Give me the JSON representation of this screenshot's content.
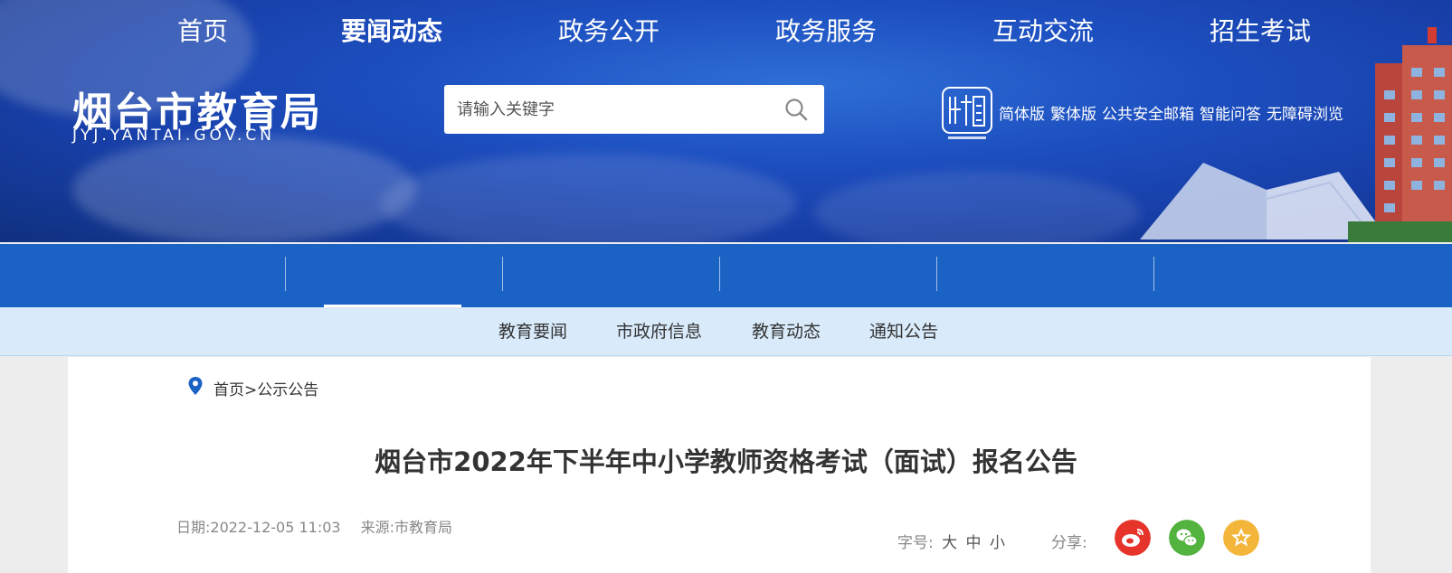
{
  "header": {
    "site_title": "烟台市教育局",
    "site_url": "JYJ.YANTAI.GOV.CN",
    "search": {
      "placeholder": "请输入关键字"
    },
    "links": [
      "简体版",
      "繁体版",
      "公共安全邮箱",
      "智能问答",
      "无障碍浏览"
    ]
  },
  "nav": {
    "items": [
      "首页",
      "要闻动态",
      "政务公开",
      "政务服务",
      "互动交流",
      "招生考试"
    ],
    "active": "要闻动态"
  },
  "subnav": {
    "items": [
      "教育要闻",
      "市政府信息",
      "教育动态",
      "通知公告"
    ]
  },
  "breadcrumb": {
    "text": "首页>公示公告"
  },
  "article": {
    "title": "烟台市2022年下半年中小学教师资格考试（面试）报名公告",
    "date": "日期:2022-12-05 11:03",
    "source": "来源:市教育局",
    "font_size_label": "字号:",
    "font_size_options": [
      "大",
      "中",
      "小"
    ],
    "share_label": "分享:"
  },
  "colors": {
    "banner": "#173fa8",
    "nav": "#1a63c4",
    "subnav": "#d9ebfb",
    "weibo": "#e6342a",
    "wechat": "#53b33f",
    "favorite": "#f3b63a"
  }
}
